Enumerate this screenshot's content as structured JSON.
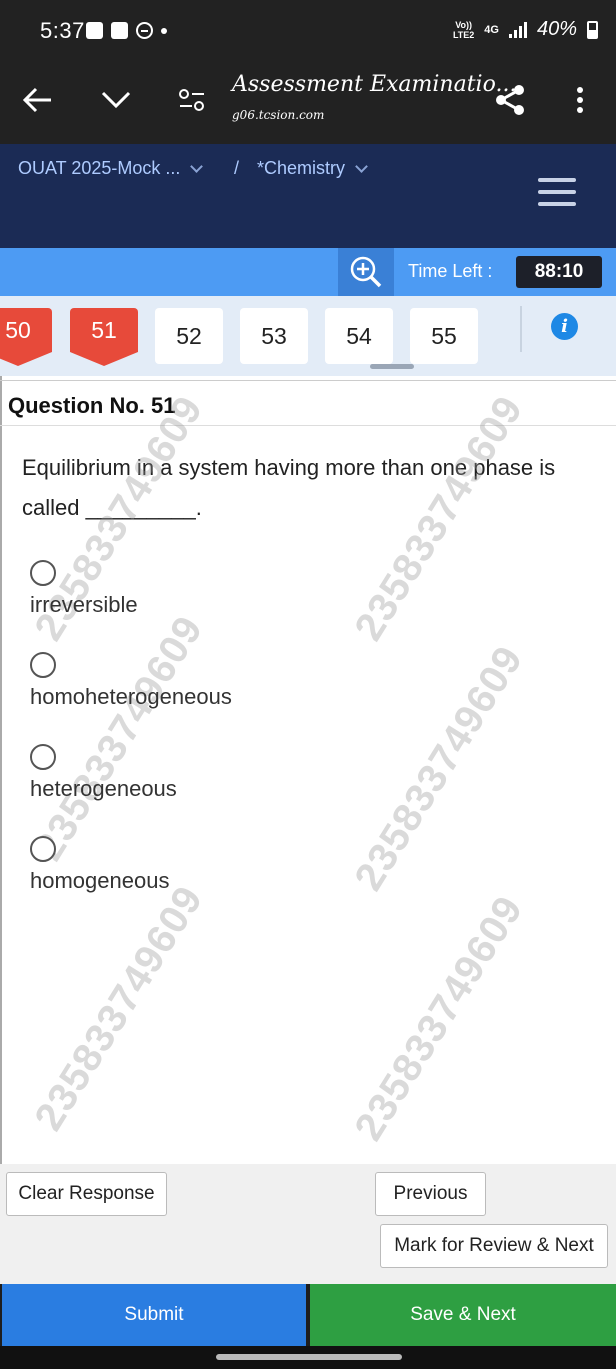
{
  "status_bar": {
    "time": "5:37",
    "network_top": "Vo))",
    "network_bottom": "LTE2",
    "net_type": "4G",
    "battery": "40%"
  },
  "app_bar": {
    "title": "Assessment Examinatio...",
    "url": "g06.tcsion.com",
    "icons": [
      "back-arrow-icon",
      "chevron-down-icon",
      "filter-settings-icon",
      "share-icon",
      "more-vert-icon"
    ]
  },
  "breadcrumb": {
    "exam": "OUAT 2025-Mock ...",
    "separator": "/",
    "section": "*Chemistry"
  },
  "timer": {
    "label": "Time Left :",
    "value": "88:10"
  },
  "palette": {
    "questions": [
      {
        "num": "50",
        "state": "not-answered"
      },
      {
        "num": "51",
        "state": "not-answered"
      },
      {
        "num": "52",
        "state": "not-visited"
      },
      {
        "num": "53",
        "state": "not-visited"
      },
      {
        "num": "54",
        "state": "not-visited"
      },
      {
        "num": "55",
        "state": "not-visited"
      }
    ]
  },
  "question": {
    "heading": "Question No. 51",
    "text": "Equilibrium in a system having more than one phase is called _________.",
    "options": [
      "irreversible",
      "homoheterogeneous",
      "heterogeneous",
      "homogeneous"
    ],
    "watermark": "235833749609"
  },
  "actions": {
    "clear": "Clear Response",
    "previous": "Previous",
    "mark_review": "Mark for Review & Next",
    "submit": "Submit",
    "save_next": "Save & Next"
  },
  "colors": {
    "header_blue": "#1b2b55",
    "timer_blue": "#4d9bf3",
    "answered_red": "#e74a3a",
    "submit_blue": "#2a7de1",
    "save_green": "#2e9f42"
  }
}
